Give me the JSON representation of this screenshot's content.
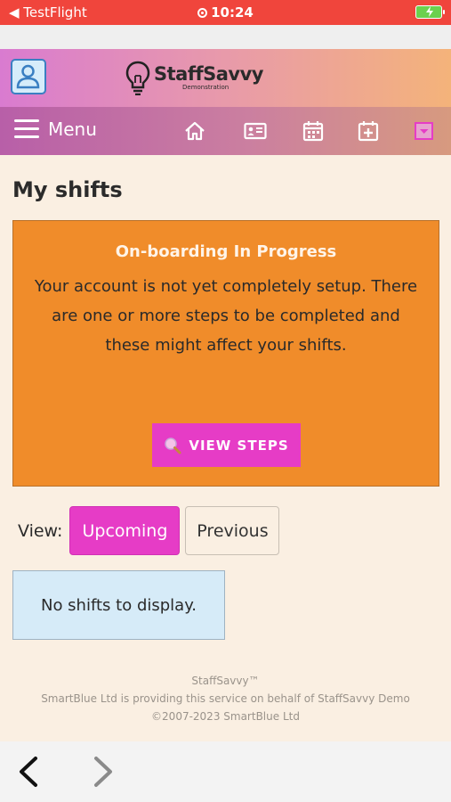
{
  "status_bar": {
    "back_app": "◀ TestFlight",
    "time": "10:24",
    "bg_color": "#f0453c"
  },
  "header": {
    "profile_icon": "user-profile-icon",
    "logo_icon": "lightbulb-icon",
    "brand_name": "StaffSavvy",
    "brand_sub": "Demonstration"
  },
  "nav": {
    "menu_label": "Menu",
    "icons": [
      "home-icon",
      "id-card-icon",
      "calendar-icon",
      "calendar-add-icon",
      "dropdown-box-icon"
    ]
  },
  "page": {
    "title": "My shifts"
  },
  "onboarding": {
    "title": "On-boarding In Progress",
    "message": "Your account is not yet completely setup. There are one or more steps to be completed and these might affect your shifts.",
    "button_label": "VIEW STEPS",
    "button_icon": "magnifier-icon",
    "bg_color": "#f08c2a",
    "button_color": "#e63cc6"
  },
  "view": {
    "label": "View:",
    "tabs": [
      {
        "label": "Upcoming",
        "active": true
      },
      {
        "label": "Previous",
        "active": false
      }
    ]
  },
  "shifts": {
    "empty_message": "No shifts to display."
  },
  "footer": {
    "line1": "StaffSavvy™",
    "line2": "SmartBlue Ltd is providing this service on behalf of StaffSavvy Demo",
    "line3": "©2007-2023 SmartBlue Ltd"
  },
  "browser_nav": {
    "back_icon": "chevron-left-icon",
    "forward_icon": "chevron-right-icon"
  }
}
